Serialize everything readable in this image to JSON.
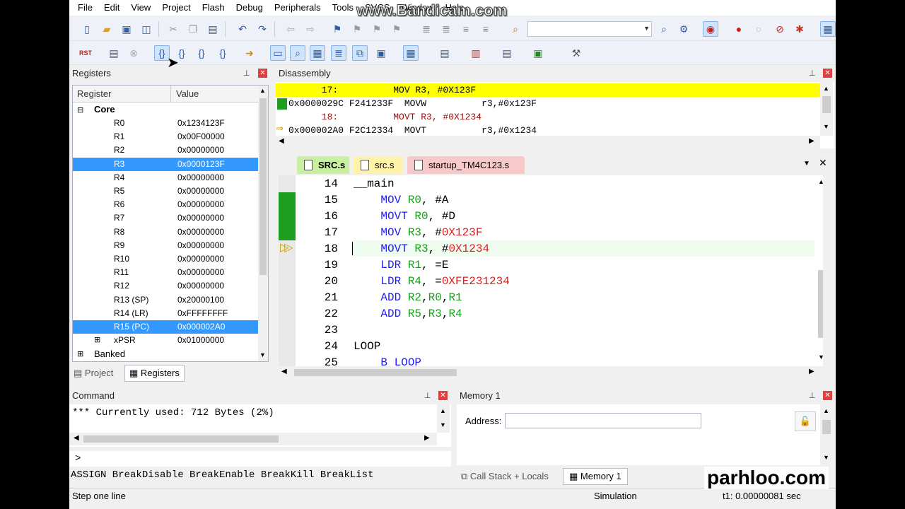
{
  "watermark": "www.Bandicam.com",
  "menu": [
    "File",
    "Edit",
    "View",
    "Project",
    "Flash",
    "Debug",
    "Peripherals",
    "Tools",
    "SVCS",
    "Window",
    "Help"
  ],
  "toolbar": {
    "rst_label": "RST"
  },
  "registers": {
    "title": "Registers",
    "col_register": "Register",
    "col_value": "Value",
    "group_core": "Core",
    "rows": [
      {
        "name": "R0",
        "value": "0x1234123F",
        "selected": false
      },
      {
        "name": "R1",
        "value": "0x00F00000",
        "selected": false
      },
      {
        "name": "R2",
        "value": "0x00000000",
        "selected": false
      },
      {
        "name": "R3",
        "value": "0x0000123F",
        "selected": true
      },
      {
        "name": "R4",
        "value": "0x00000000",
        "selected": false
      },
      {
        "name": "R5",
        "value": "0x00000000",
        "selected": false
      },
      {
        "name": "R6",
        "value": "0x00000000",
        "selected": false
      },
      {
        "name": "R7",
        "value": "0x00000000",
        "selected": false
      },
      {
        "name": "R8",
        "value": "0x00000000",
        "selected": false
      },
      {
        "name": "R9",
        "value": "0x00000000",
        "selected": false
      },
      {
        "name": "R10",
        "value": "0x00000000",
        "selected": false
      },
      {
        "name": "R11",
        "value": "0x00000000",
        "selected": false
      },
      {
        "name": "R12",
        "value": "0x00000000",
        "selected": false
      },
      {
        "name": "R13 (SP)",
        "value": "0x20000100",
        "selected": false
      },
      {
        "name": "R14 (LR)",
        "value": "0xFFFFFFFF",
        "selected": false
      },
      {
        "name": "R15 (PC)",
        "value": "0x000002A0",
        "selected": true
      },
      {
        "name": "xPSR",
        "value": "0x01000000",
        "selected": false
      }
    ],
    "group_banked": "Banked",
    "tab_project": "Project",
    "tab_registers": "Registers"
  },
  "disassembly": {
    "title": "Disassembly",
    "lines": [
      "      17:          MOV R3, #0X123F",
      "0x0000029C F241233F  MOVW          r3,#0x123F",
      "      18:          MOVT R3, #0X1234",
      "0x000002A0 F2C12334  MOVT          r3,#0x1234"
    ]
  },
  "editor": {
    "tabs": [
      "SRC.s",
      "src.s",
      "startup_TM4C123.s"
    ],
    "lines": [
      {
        "num": "14",
        "parts": [
          {
            "t": "__main",
            "c": ""
          }
        ]
      },
      {
        "num": "15",
        "parts": [
          {
            "t": "    MOV ",
            "c": "kw"
          },
          {
            "t": "R0",
            "c": "rg"
          },
          {
            "t": ", #A",
            "c": ""
          }
        ]
      },
      {
        "num": "16",
        "parts": [
          {
            "t": "    MOVT ",
            "c": "kw"
          },
          {
            "t": "R0",
            "c": "rg"
          },
          {
            "t": ", #D",
            "c": ""
          }
        ]
      },
      {
        "num": "17",
        "parts": [
          {
            "t": "    MOV ",
            "c": "kw"
          },
          {
            "t": "R3",
            "c": "rg"
          },
          {
            "t": ", #",
            "c": ""
          },
          {
            "t": "0X123F",
            "c": "nm"
          }
        ]
      },
      {
        "num": "18",
        "parts": [
          {
            "t": "    MOVT ",
            "c": "kw"
          },
          {
            "t": "R3",
            "c": "rg"
          },
          {
            "t": ", #",
            "c": ""
          },
          {
            "t": "0X1234",
            "c": "nm"
          }
        ]
      },
      {
        "num": "19",
        "parts": [
          {
            "t": "    LDR ",
            "c": "kw"
          },
          {
            "t": "R1",
            "c": "rg"
          },
          {
            "t": ", =E",
            "c": ""
          }
        ]
      },
      {
        "num": "20",
        "parts": [
          {
            "t": "    LDR ",
            "c": "kw"
          },
          {
            "t": "R4",
            "c": "rg"
          },
          {
            "t": ", =",
            "c": ""
          },
          {
            "t": "0XFE231234",
            "c": "nm"
          }
        ]
      },
      {
        "num": "21",
        "parts": [
          {
            "t": "    ADD ",
            "c": "kw"
          },
          {
            "t": "R2",
            "c": "rg"
          },
          {
            "t": ",",
            "c": ""
          },
          {
            "t": "R0",
            "c": "rg"
          },
          {
            "t": ",",
            "c": ""
          },
          {
            "t": "R1",
            "c": "rg"
          }
        ]
      },
      {
        "num": "22",
        "parts": [
          {
            "t": "    ADD ",
            "c": "kw"
          },
          {
            "t": "R5",
            "c": "rg"
          },
          {
            "t": ",",
            "c": ""
          },
          {
            "t": "R3",
            "c": "rg"
          },
          {
            "t": ",",
            "c": ""
          },
          {
            "t": "R4",
            "c": "rg"
          }
        ]
      },
      {
        "num": "23",
        "parts": [
          {
            "t": "",
            "c": ""
          }
        ]
      },
      {
        "num": "24",
        "parts": [
          {
            "t": "LOOP",
            "c": ""
          }
        ]
      },
      {
        "num": "25",
        "parts": [
          {
            "t": "    B LOOP",
            "c": "kw"
          }
        ]
      }
    ]
  },
  "command": {
    "title": "Command",
    "output": "*** Currently used: 712 Bytes (2%)",
    "prompt": ">",
    "hints": "ASSIGN BreakDisable BreakEnable BreakKill BreakList"
  },
  "memory": {
    "title": "Memory 1",
    "address_label": "Address:",
    "address_value": "",
    "tab_callstack": "Call Stack + Locals",
    "tab_memory": "Memory 1"
  },
  "overlay_text": "parhloo.com",
  "status": {
    "left": "Step one line",
    "mode": "Simulation",
    "time": "t1: 0.00000081 sec"
  },
  "colors": {
    "selection": "#3399ff",
    "current_line": "#ffff00",
    "keyword": "#1c1cff",
    "register": "#15a015",
    "number": "#e01e1e",
    "exec_marker": "#1e9e1e"
  }
}
